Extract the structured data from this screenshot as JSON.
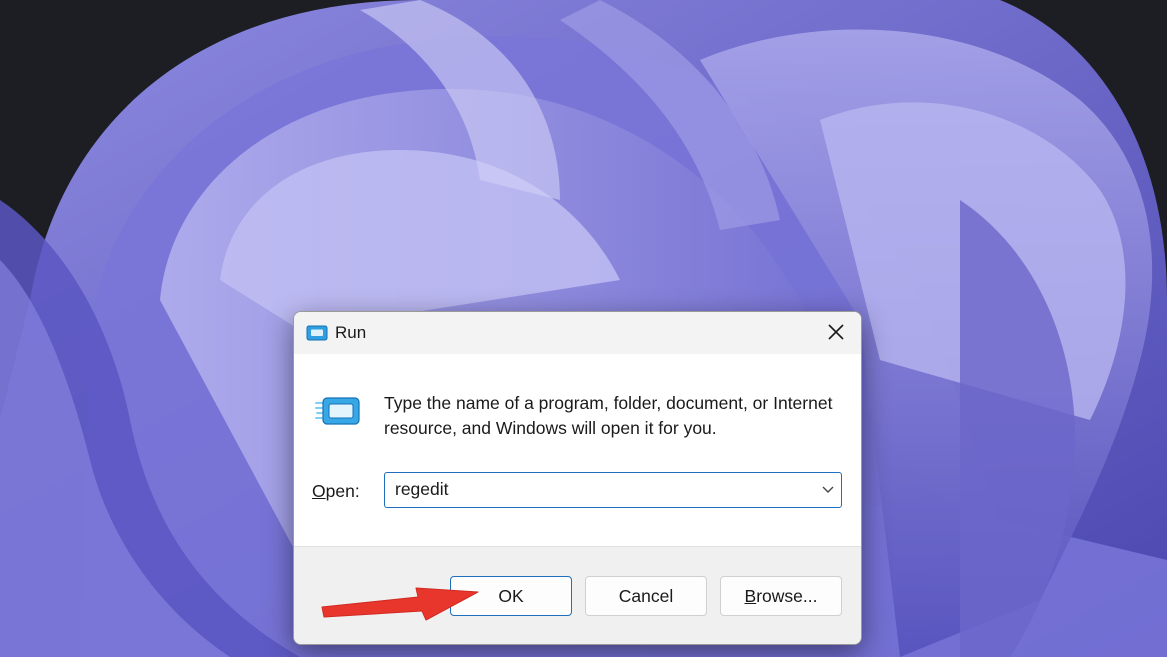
{
  "window": {
    "title": "Run",
    "close_glyph": "✕"
  },
  "dialog": {
    "description": "Type the name of a program, folder, document, or Internet resource, and Windows will open it for you.",
    "open_label_accel": "O",
    "open_label_rest": "pen:",
    "open_value": "regedit",
    "ok_label": "OK",
    "cancel_label": "Cancel",
    "browse_label_accel": "B",
    "browse_label_rest": "rowse..."
  },
  "icons": {
    "title_icon": "run-icon",
    "dialog_icon": "run-icon",
    "close_icon": "close-icon",
    "combo_arrow": "chevron-down-icon",
    "annotation": "red-arrow-icon"
  },
  "colors": {
    "accent": "#1f6fbf",
    "wallpaper_purple": "#6b67c9",
    "annotation_red": "#e8362d"
  }
}
